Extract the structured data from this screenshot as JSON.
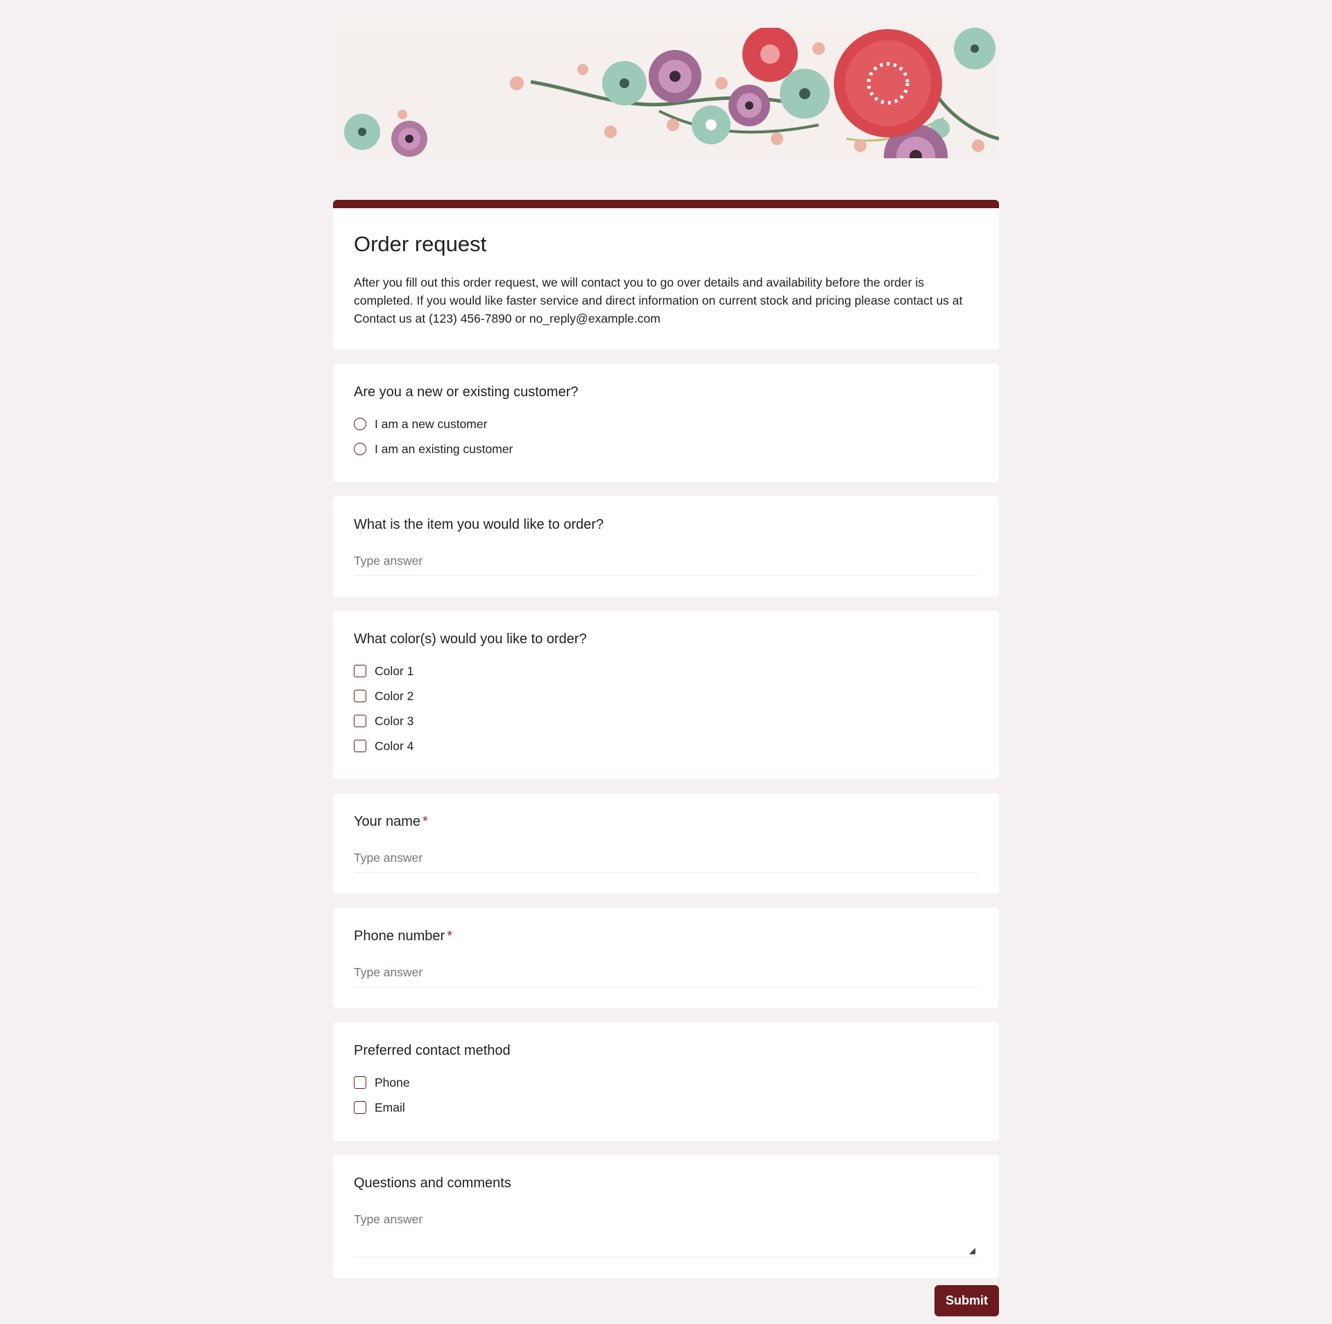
{
  "form": {
    "title": "Order request",
    "description": "After you fill out this order request, we will contact you to go over details and availability before the order is completed. If you would like faster service and direct information on current stock and pricing please contact us at Contact us at (123) 456-7890 or no_reply@example.com"
  },
  "questions": {
    "customer": {
      "label": "Are you a new or existing customer?",
      "options": [
        "I am a new customer",
        "I am an existing customer"
      ]
    },
    "item": {
      "label": "What is the item you would like to order?",
      "placeholder": "Type answer"
    },
    "colors": {
      "label": "What color(s) would you like to order?",
      "options": [
        "Color 1",
        "Color 2",
        "Color 3",
        "Color 4"
      ]
    },
    "name": {
      "label": "Your name",
      "required_mark": "*",
      "placeholder": "Type answer"
    },
    "phone": {
      "label": "Phone number",
      "required_mark": "*",
      "placeholder": "Type answer"
    },
    "contact": {
      "label": "Preferred contact method",
      "options": [
        "Phone",
        "Email"
      ]
    },
    "comments": {
      "label": "Questions and comments",
      "placeholder": "Type answer"
    }
  },
  "submit_label": "Submit",
  "colors": {
    "accent": "#6b1a1e",
    "required": "#a4262c",
    "page_bg": "#f5f1f1"
  }
}
